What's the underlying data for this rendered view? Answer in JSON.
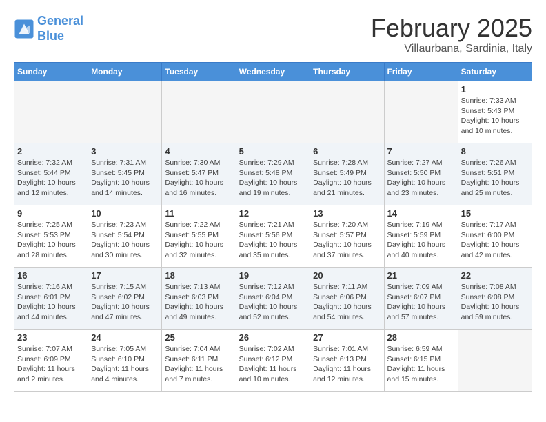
{
  "logo": {
    "line1": "General",
    "line2": "Blue"
  },
  "title": "February 2025",
  "location": "Villaurbana, Sardinia, Italy",
  "weekdays": [
    "Sunday",
    "Monday",
    "Tuesday",
    "Wednesday",
    "Thursday",
    "Friday",
    "Saturday"
  ],
  "weeks": [
    [
      {
        "day": "",
        "info": ""
      },
      {
        "day": "",
        "info": ""
      },
      {
        "day": "",
        "info": ""
      },
      {
        "day": "",
        "info": ""
      },
      {
        "day": "",
        "info": ""
      },
      {
        "day": "",
        "info": ""
      },
      {
        "day": "1",
        "info": "Sunrise: 7:33 AM\nSunset: 5:43 PM\nDaylight: 10 hours\nand 10 minutes."
      }
    ],
    [
      {
        "day": "2",
        "info": "Sunrise: 7:32 AM\nSunset: 5:44 PM\nDaylight: 10 hours\nand 12 minutes."
      },
      {
        "day": "3",
        "info": "Sunrise: 7:31 AM\nSunset: 5:45 PM\nDaylight: 10 hours\nand 14 minutes."
      },
      {
        "day": "4",
        "info": "Sunrise: 7:30 AM\nSunset: 5:47 PM\nDaylight: 10 hours\nand 16 minutes."
      },
      {
        "day": "5",
        "info": "Sunrise: 7:29 AM\nSunset: 5:48 PM\nDaylight: 10 hours\nand 19 minutes."
      },
      {
        "day": "6",
        "info": "Sunrise: 7:28 AM\nSunset: 5:49 PM\nDaylight: 10 hours\nand 21 minutes."
      },
      {
        "day": "7",
        "info": "Sunrise: 7:27 AM\nSunset: 5:50 PM\nDaylight: 10 hours\nand 23 minutes."
      },
      {
        "day": "8",
        "info": "Sunrise: 7:26 AM\nSunset: 5:51 PM\nDaylight: 10 hours\nand 25 minutes."
      }
    ],
    [
      {
        "day": "9",
        "info": "Sunrise: 7:25 AM\nSunset: 5:53 PM\nDaylight: 10 hours\nand 28 minutes."
      },
      {
        "day": "10",
        "info": "Sunrise: 7:23 AM\nSunset: 5:54 PM\nDaylight: 10 hours\nand 30 minutes."
      },
      {
        "day": "11",
        "info": "Sunrise: 7:22 AM\nSunset: 5:55 PM\nDaylight: 10 hours\nand 32 minutes."
      },
      {
        "day": "12",
        "info": "Sunrise: 7:21 AM\nSunset: 5:56 PM\nDaylight: 10 hours\nand 35 minutes."
      },
      {
        "day": "13",
        "info": "Sunrise: 7:20 AM\nSunset: 5:57 PM\nDaylight: 10 hours\nand 37 minutes."
      },
      {
        "day": "14",
        "info": "Sunrise: 7:19 AM\nSunset: 5:59 PM\nDaylight: 10 hours\nand 40 minutes."
      },
      {
        "day": "15",
        "info": "Sunrise: 7:17 AM\nSunset: 6:00 PM\nDaylight: 10 hours\nand 42 minutes."
      }
    ],
    [
      {
        "day": "16",
        "info": "Sunrise: 7:16 AM\nSunset: 6:01 PM\nDaylight: 10 hours\nand 44 minutes."
      },
      {
        "day": "17",
        "info": "Sunrise: 7:15 AM\nSunset: 6:02 PM\nDaylight: 10 hours\nand 47 minutes."
      },
      {
        "day": "18",
        "info": "Sunrise: 7:13 AM\nSunset: 6:03 PM\nDaylight: 10 hours\nand 49 minutes."
      },
      {
        "day": "19",
        "info": "Sunrise: 7:12 AM\nSunset: 6:04 PM\nDaylight: 10 hours\nand 52 minutes."
      },
      {
        "day": "20",
        "info": "Sunrise: 7:11 AM\nSunset: 6:06 PM\nDaylight: 10 hours\nand 54 minutes."
      },
      {
        "day": "21",
        "info": "Sunrise: 7:09 AM\nSunset: 6:07 PM\nDaylight: 10 hours\nand 57 minutes."
      },
      {
        "day": "22",
        "info": "Sunrise: 7:08 AM\nSunset: 6:08 PM\nDaylight: 10 hours\nand 59 minutes."
      }
    ],
    [
      {
        "day": "23",
        "info": "Sunrise: 7:07 AM\nSunset: 6:09 PM\nDaylight: 11 hours\nand 2 minutes."
      },
      {
        "day": "24",
        "info": "Sunrise: 7:05 AM\nSunset: 6:10 PM\nDaylight: 11 hours\nand 4 minutes."
      },
      {
        "day": "25",
        "info": "Sunrise: 7:04 AM\nSunset: 6:11 PM\nDaylight: 11 hours\nand 7 minutes."
      },
      {
        "day": "26",
        "info": "Sunrise: 7:02 AM\nSunset: 6:12 PM\nDaylight: 11 hours\nand 10 minutes."
      },
      {
        "day": "27",
        "info": "Sunrise: 7:01 AM\nSunset: 6:13 PM\nDaylight: 11 hours\nand 12 minutes."
      },
      {
        "day": "28",
        "info": "Sunrise: 6:59 AM\nSunset: 6:15 PM\nDaylight: 11 hours\nand 15 minutes."
      },
      {
        "day": "",
        "info": ""
      }
    ]
  ]
}
